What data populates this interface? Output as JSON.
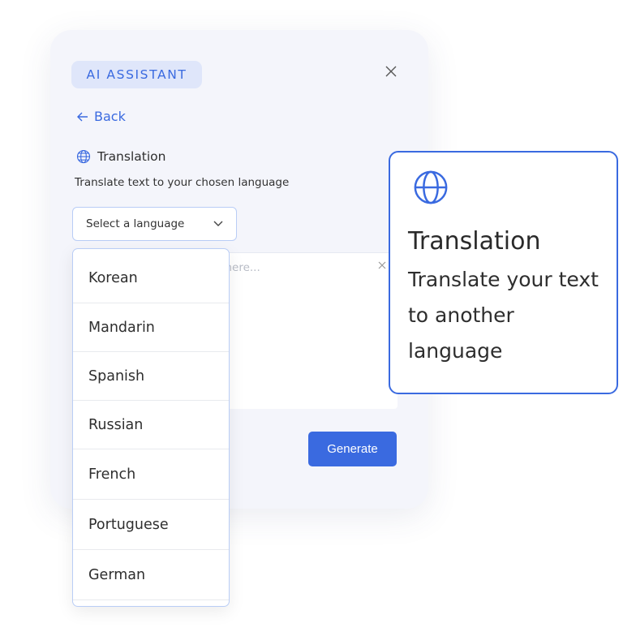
{
  "panel": {
    "badge": "AI ASSISTANT",
    "back_label": "Back",
    "tool_title": "Translation",
    "tool_description": "Translate text to your chosen language",
    "select": {
      "placeholder": "Select a language"
    },
    "textarea": {
      "placeholder": "Enter text here..."
    },
    "generate_label": "Generate"
  },
  "dropdown": {
    "options": [
      "Korean",
      "Mandarin",
      "Spanish",
      "Russian",
      "French",
      "Portuguese",
      "German"
    ]
  },
  "tooltip_card": {
    "title": "Translation",
    "description": "Translate your text to another language",
    "icon": "globe-icon"
  },
  "colors": {
    "accent": "#3a6ae0",
    "badge_bg": "#dfe6fa",
    "panel_bg": "#f4f5fb"
  }
}
